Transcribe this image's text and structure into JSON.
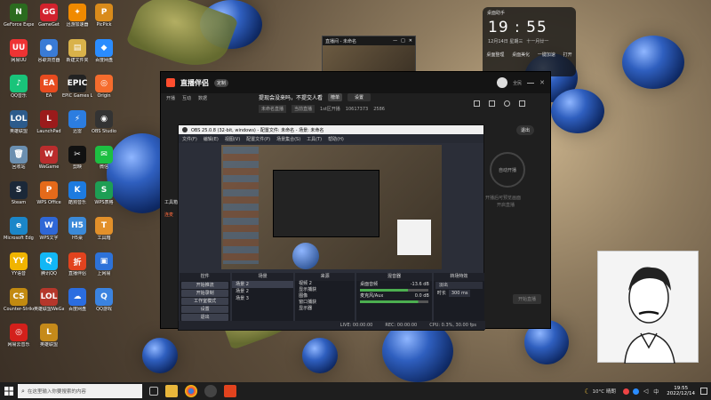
{
  "desktop": {
    "icons": [
      {
        "label": "GeForce Experience",
        "glyph": "N",
        "color": "#2b6b1f"
      },
      {
        "label": "GameGet",
        "glyph": "GG",
        "color": "#d2222d"
      },
      {
        "label": "迅游加速器",
        "glyph": "✦",
        "color": "#f08a00"
      },
      {
        "label": "PicPick",
        "glyph": "P",
        "color": "#d98b1b"
      },
      {
        "label": "网易UU",
        "glyph": "UU",
        "color": "#e33"
      },
      {
        "label": "谷歌浏览器",
        "glyph": "●",
        "color": "#3a7bd5"
      },
      {
        "label": "新建文件夹",
        "glyph": "▤",
        "color": "#d9b24a"
      },
      {
        "label": "百度网盘",
        "glyph": "◆",
        "color": "#2a8cff"
      },
      {
        "label": "QQ音乐",
        "glyph": "♪",
        "color": "#19c47a"
      },
      {
        "label": "EA",
        "glyph": "EA",
        "color": "#e84b1f"
      },
      {
        "label": "EPIC Games Launcher",
        "glyph": "EPIC",
        "color": "#222"
      },
      {
        "label": "Origin",
        "glyph": "◎",
        "color": "#f56c2d"
      },
      {
        "label": "英雄联盟",
        "glyph": "LOL",
        "color": "#2c5b8c"
      },
      {
        "label": "LaunchPad",
        "glyph": "L",
        "color": "#9b1b1b"
      },
      {
        "label": "迅雷",
        "glyph": "⚡",
        "color": "#2c7de0"
      },
      {
        "label": "OBS Studio",
        "glyph": "◉",
        "color": "#333"
      },
      {
        "label": "回收站",
        "glyph": "🗑",
        "color": "#6b8fb0"
      },
      {
        "label": "WeGame",
        "glyph": "W",
        "color": "#ba2d2d"
      },
      {
        "label": "剪映",
        "glyph": "✂",
        "color": "#111"
      },
      {
        "label": "微信",
        "glyph": "✉",
        "color": "#1dbf42"
      },
      {
        "label": "Steam",
        "glyph": "S",
        "color": "#1b2838"
      },
      {
        "label": "WPS Office",
        "glyph": "P",
        "color": "#e56a1a"
      },
      {
        "label": "酷狗音乐",
        "glyph": "K",
        "color": "#1d7be0"
      },
      {
        "label": "WPS表格",
        "glyph": "S",
        "color": "#1d9e54"
      },
      {
        "label": "Microsoft Edge",
        "glyph": "e",
        "color": "#1b86c9"
      },
      {
        "label": "WPS文字",
        "glyph": "W",
        "color": "#2f67d6"
      },
      {
        "label": "H5桌",
        "glyph": "H5",
        "color": "#3b8ad9"
      },
      {
        "label": "工具箱",
        "glyph": "T",
        "color": "#e2902a"
      },
      {
        "label": "YY语音",
        "glyph": "YY",
        "color": "#f0b400"
      },
      {
        "label": "腾讯QQ",
        "glyph": "Q",
        "color": "#12b7f5"
      },
      {
        "label": "直播伴侣",
        "glyph": "折",
        "color": "#e2431e"
      },
      {
        "label": "上网易",
        "glyph": "▣",
        "color": "#2d72d9"
      },
      {
        "label": "Counter-Strike Global",
        "glyph": "CS",
        "color": "#c28a10"
      },
      {
        "label": "英雄联盟WeGame",
        "glyph": "LOL",
        "color": "#b5372b"
      },
      {
        "label": "百度网盘",
        "glyph": "☁",
        "color": "#2b6de0"
      },
      {
        "label": "QQ游戏",
        "glyph": "Q",
        "color": "#3b83e0"
      },
      {
        "label": "网易云音乐",
        "glyph": "◎",
        "color": "#d3201b"
      },
      {
        "label": "英雄联盟",
        "glyph": "L",
        "color": "#c58a1a"
      }
    ]
  },
  "topMini": {
    "title": "直播间 - 未命名",
    "buttons": [
      "—",
      "□",
      "✕"
    ]
  },
  "clockWidget": {
    "header": "桌面助手",
    "time": "19 : 55",
    "date": "12月14日 星期三",
    "lunar": "十一月廿一",
    "actions": [
      "桌面整理",
      "桌面美化",
      "一键加速",
      "打开"
    ]
  },
  "mainApp": {
    "brand": "直播伴侣",
    "badge": "定制",
    "tabs": [
      "开播",
      "互动",
      "数据"
    ],
    "titlebarText": "全民",
    "headline": "提现会没来吗，不提交人看",
    "chip1": "榜单",
    "chip2": "设置",
    "metaChips": [
      "未命名直播",
      "当前直播"
    ],
    "stat1": "1st区开播",
    "stat2": "10617373",
    "stat3": "2586",
    "sideTools": [
      "工具箱",
      "连麦"
    ],
    "actionRight": "退出",
    "startLive": "自动开播",
    "startHint": "开播后可预览画面",
    "startHint2": "开启直播",
    "bottomButton": "开始直播"
  },
  "obs": {
    "title": "OBS 25.0.8 (32-bit, windows) - 配置文件: 未命名 - 场景: 未命名",
    "menu": [
      "文件(F)",
      "编辑(E)",
      "视图(V)",
      "配置文件(P)",
      "场景集合(S)",
      "工具(T)",
      "帮助(H)"
    ],
    "docks": {
      "controls": {
        "title": "控件",
        "buttons": [
          "开始推流",
          "开始录制",
          "工作室模式",
          "设置",
          "退出"
        ]
      },
      "scenes": {
        "title": "场景",
        "items": [
          "场景 2",
          "场景 2",
          "场景 3"
        ]
      },
      "sources": {
        "title": "来源",
        "items": [
          "视频 2",
          "显示捕获",
          "图像",
          "窗口捕获",
          "显示器"
        ]
      },
      "mixer": {
        "title": "混音器",
        "items": [
          "桌面音频",
          "麦克风/Aux"
        ],
        "levels": [
          "-13.6 dB",
          "0.0 dB"
        ]
      },
      "transitions": {
        "title": "转场特效",
        "fade": "淡出",
        "duration_label": "时长",
        "duration": "300 ms"
      }
    },
    "status": [
      "LIVE: 00:00:00",
      "REC: 00:00:00",
      "CPU: 0.3%, 30.00 fps"
    ]
  },
  "taskbar": {
    "search_placeholder": "在这里输入你要搜索的内容",
    "weather": "10°C 晴朗",
    "time": "19:55",
    "date": "2022/12/14",
    "lang": "中"
  }
}
